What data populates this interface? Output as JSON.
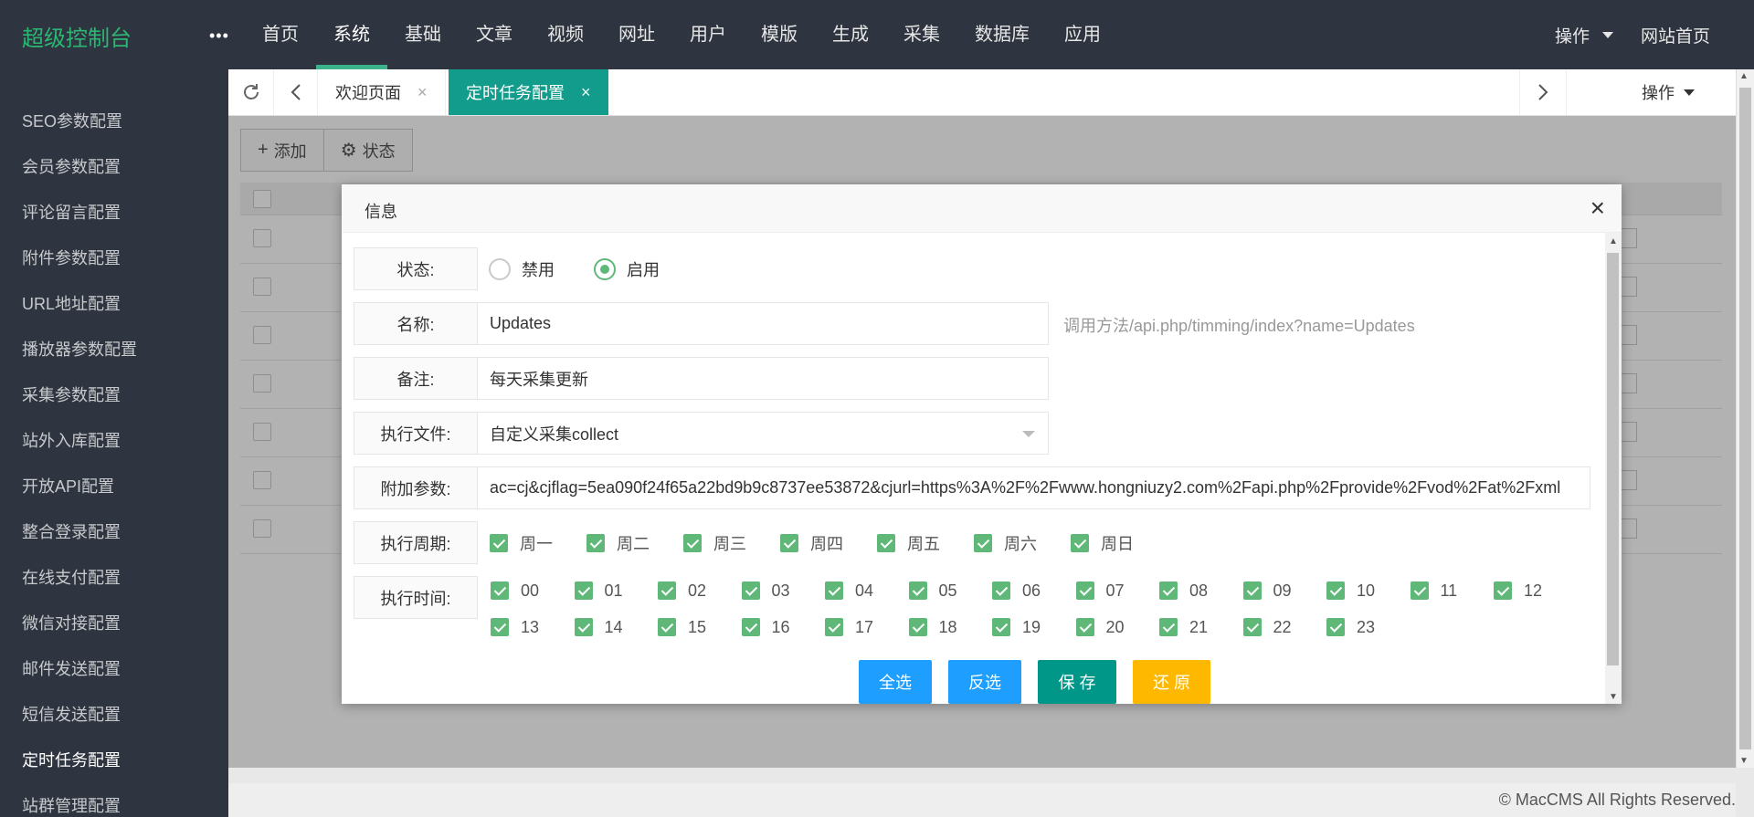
{
  "app": {
    "title": "超级控制台",
    "more": "•••",
    "nav": [
      "首页",
      "系统",
      "基础",
      "文章",
      "视频",
      "网址",
      "用户",
      "模版",
      "生成",
      "采集",
      "数据库",
      "应用"
    ],
    "nav_active": "系统",
    "ops_label": "操作",
    "home_label": "网站首页"
  },
  "sidebar": {
    "items": [
      "SEO参数配置",
      "会员参数配置",
      "评论留言配置",
      "附件参数配置",
      "URL地址配置",
      "播放器参数配置",
      "采集参数配置",
      "站外入库配置",
      "开放API配置",
      "整合登录配置",
      "在线支付配置",
      "微信对接配置",
      "邮件发送配置",
      "短信发送配置",
      "定时任务配置",
      "站群管理配置"
    ],
    "active": "定时任务配置"
  },
  "tabs": {
    "items": [
      {
        "label": "欢迎页面",
        "close": "×"
      },
      {
        "label": "定时任务配置",
        "close": "×"
      }
    ],
    "ops_label": "操作"
  },
  "toolbar": {
    "add_label": "添加",
    "status_label": "状态"
  },
  "modal": {
    "title": "信息",
    "close": "×",
    "status_label": "状态:",
    "status_options": [
      "禁用",
      "启用"
    ],
    "status_selected": "启用",
    "name_label": "名称:",
    "name_value": "Updates",
    "name_hint": "调用方法/api.php/timming/index?name=Updates",
    "remark_label": "备注:",
    "remark_value": "每天采集更新",
    "file_label": "执行文件:",
    "file_value": "自定义采集collect",
    "params_label": "附加参数:",
    "params_value": "ac=cj&cjflag=5ea090f24f65a22bd9b9c8737ee53872&cjurl=https%3A%2F%2Fwww.hongniuzy2.com%2Fapi.php%2Fprovide%2Fvod%2Fat%2Fxml",
    "week_label": "执行周期:",
    "week_days": [
      "周一",
      "周二",
      "周三",
      "周四",
      "周五",
      "周六",
      "周日"
    ],
    "hours_label": "执行时间:",
    "hours_row1": [
      "00",
      "01",
      "02",
      "03",
      "04",
      "05",
      "06",
      "07",
      "08",
      "09",
      "10",
      "11",
      "12"
    ],
    "hours_row2": [
      "13",
      "14",
      "15",
      "16",
      "17",
      "18",
      "19",
      "20",
      "21",
      "22",
      "23"
    ],
    "buttons": {
      "select_all": "全选",
      "invert": "反选",
      "save": "保 存",
      "reset": "还 原"
    }
  },
  "footer": {
    "copyright": "© MacCMS All Rights Reserved."
  },
  "colors": {
    "topbar": "#2f3540",
    "logo": "#2bb673",
    "active_tab": "#129c8b",
    "check": "#5fb878",
    "blue_btn": "#1e9fff",
    "teal_btn": "#009688",
    "orange_btn": "#ffb800"
  }
}
